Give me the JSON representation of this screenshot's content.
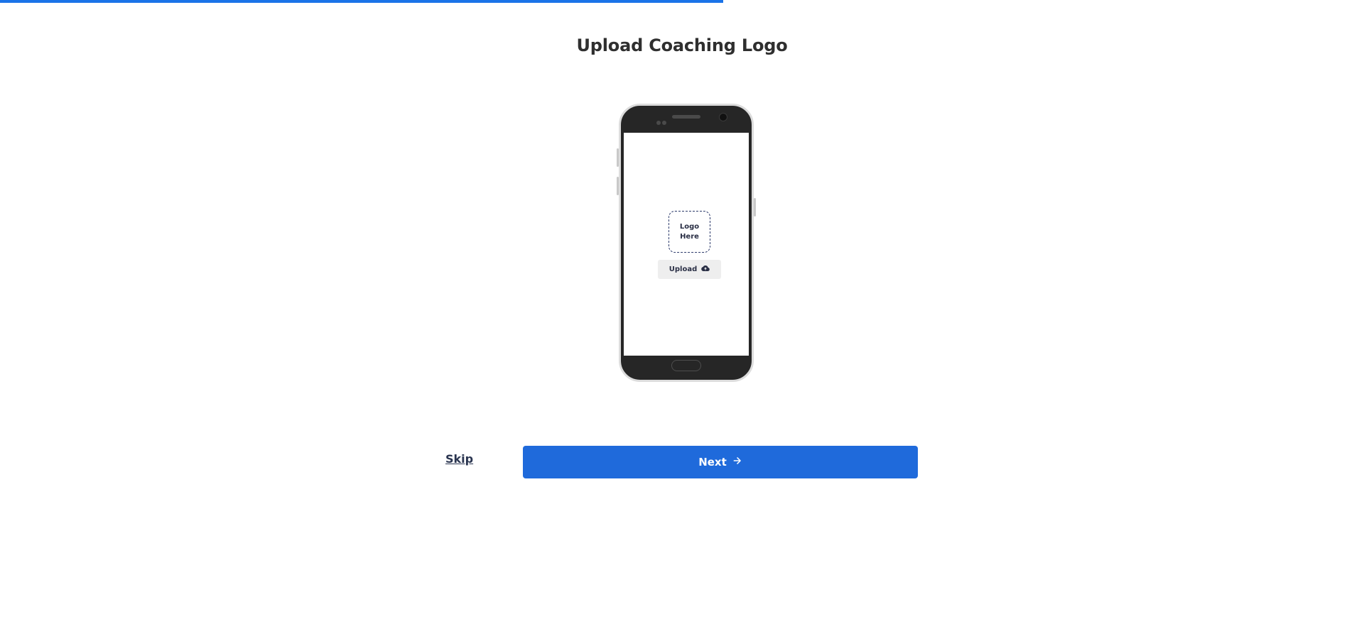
{
  "progress": {
    "fraction": 0.53,
    "color": "#1a73e8"
  },
  "page": {
    "title": "Upload Coaching Logo"
  },
  "phone": {
    "logo_placeholder_line1": "Logo",
    "logo_placeholder_line2": "Here",
    "upload_label": "Upload",
    "upload_icon": "cloud-upload-icon"
  },
  "actions": {
    "skip_label": "Skip",
    "next_label": "Next",
    "next_icon": "arrow-right-icon",
    "accent_color": "#1f6adb"
  }
}
